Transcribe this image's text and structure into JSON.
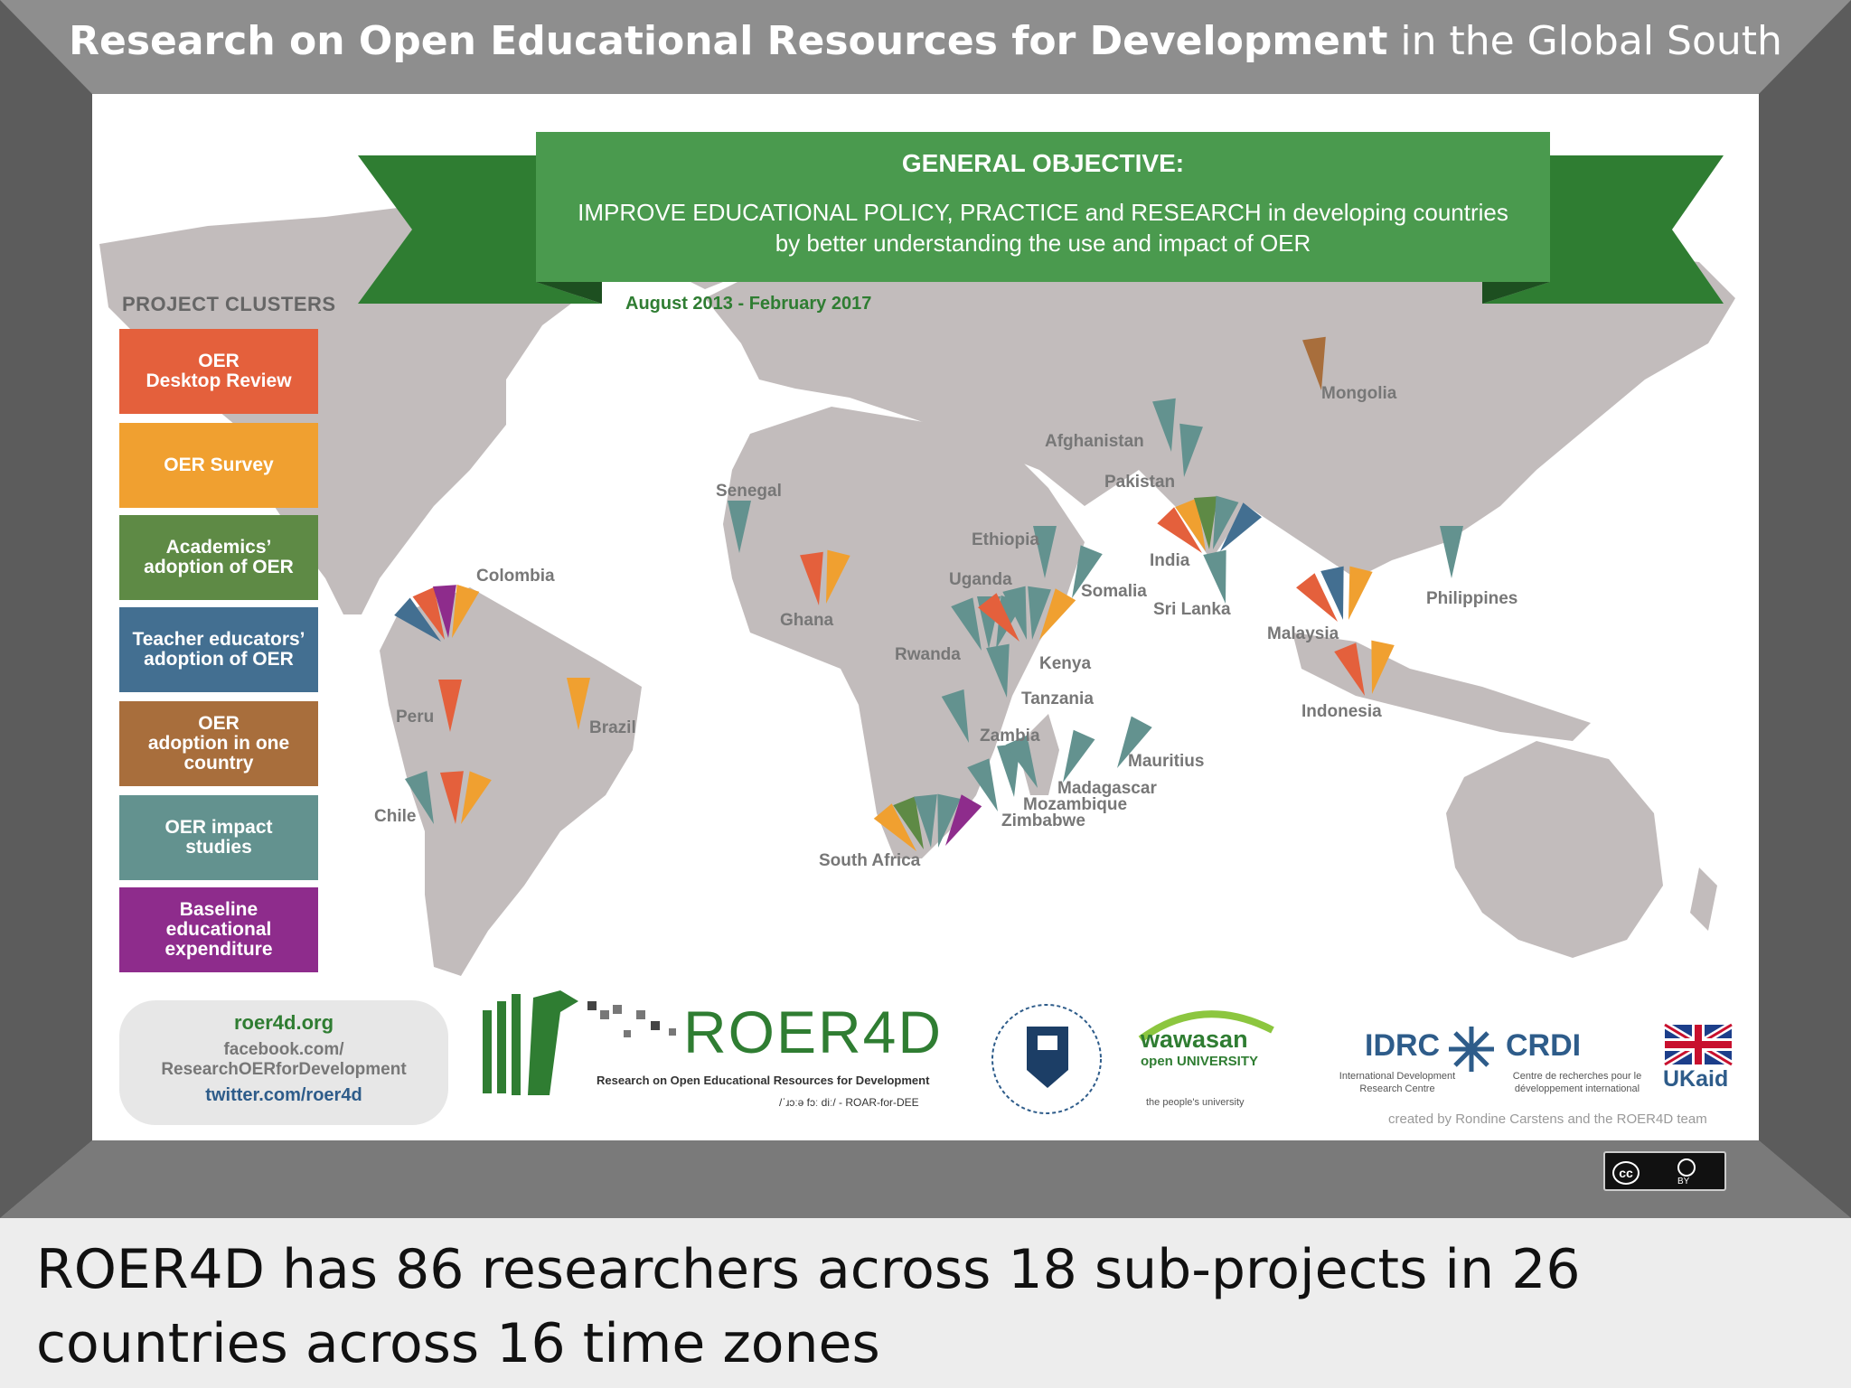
{
  "title": {
    "bold": "Research on Open Educational Resources for Development",
    "light": "in the Global South"
  },
  "banner": {
    "title": "GENERAL OBJECTIVE:",
    "line1": "IMPROVE EDUCATIONAL POLICY, PRACTICE and RESEARCH in developing countries",
    "line2": "by better understanding the use and impact of OER"
  },
  "dates": "August 2013 - February 2017",
  "clusters": {
    "heading": "PROJECT CLUSTERS",
    "items": [
      {
        "label": "OER\nDesktop Review",
        "color": "#e4603c"
      },
      {
        "label": "OER Survey",
        "color": "#f0a030"
      },
      {
        "label": "Academics’\nadoption of OER",
        "color": "#5e8a45"
      },
      {
        "label": "Teacher educators’\nadoption of OER",
        "color": "#436f91"
      },
      {
        "label": "OER\nadoption in one\ncountry",
        "color": "#a86e3c"
      },
      {
        "label": "OER impact\nstudies",
        "color": "#63928f"
      },
      {
        "label": "Baseline\neducational\nexpenditure",
        "color": "#8e2c8c"
      }
    ]
  },
  "countries": [
    "Colombia",
    "Peru",
    "Brazil",
    "Chile",
    "Senegal",
    "Ghana",
    "Ethiopia",
    "Uganda",
    "Rwanda",
    "Kenya",
    "Tanzania",
    "Zambia",
    "Somalia",
    "Mauritius",
    "Madagascar",
    "Mozambique",
    "Zimbabwe",
    "South Africa",
    "Afghanistan",
    "Pakistan",
    "India",
    "Sri Lanka",
    "Mongolia",
    "Malaysia",
    "Indonesia",
    "Philippines"
  ],
  "contact": {
    "web": "roer4d.org",
    "facebook": "facebook.com/\nResearchOERforDevelopment",
    "twitter": "twitter.com/roer4d"
  },
  "logos": {
    "roer_name": "ROER4D",
    "roer_sub": "Research on Open Educational Resources for Development",
    "roer_phon": "/ˈɹɔːə fɔː diː/ - ROAR-for-DEE",
    "wawasan": "wawasan",
    "wawasan_sub": "open UNIVERSITY",
    "wawasan_tag": "the people's university",
    "idrc": "IDRC",
    "idrc_sub": "International Development\nResearch Centre",
    "crdi": "CRDI",
    "crdi_sub": "Centre de recherches pour le\ndéveloppement international",
    "ukaid": "UKaid"
  },
  "credit": "created by Rondine Carstens and the ROER4D team",
  "license": {
    "cc": "cc",
    "by": "BY"
  },
  "caption": "ROER4D has 86 researchers across 18 sub-projects in 26 countries across 16 time zones"
}
